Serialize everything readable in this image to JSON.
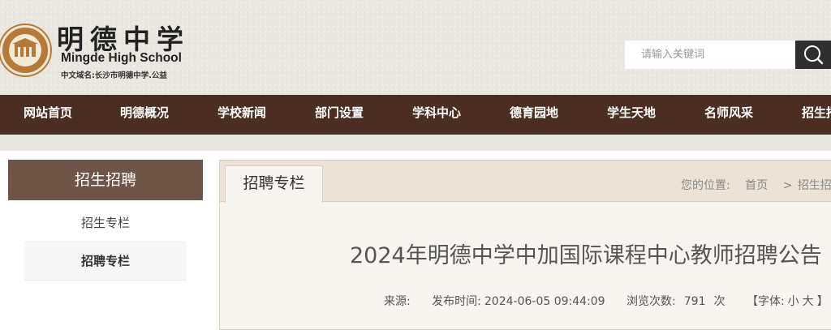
{
  "header": {
    "logo_seal_text": "明德 HIGH SCHOOL 1903",
    "logo_cn": "明德中学",
    "logo_en": "Mingde High School",
    "domain_text": "中文域名:长沙市明德中学.公益"
  },
  "search": {
    "placeholder": "请输入关键词",
    "button_icon": "search-icon"
  },
  "nav": {
    "items": [
      "网站首页",
      "明德概况",
      "学校新闻",
      "部门设置",
      "学科中心",
      "德育园地",
      "学生天地",
      "名师风采",
      "招生招聘"
    ]
  },
  "sidebar": {
    "title": "招生招聘",
    "items": [
      {
        "label": "招生专栏"
      },
      {
        "label": "招聘专栏"
      }
    ]
  },
  "content": {
    "tab_label": "招聘专栏",
    "breadcrumb": {
      "prefix": "您的位置:",
      "home": "首页",
      "sep": ">",
      "current": "招生招聘"
    },
    "article": {
      "title": "2024年明德中学中加国际课程中心教师招聘公告",
      "source_label": "来源:",
      "time_label": "发布时间:",
      "time": "2024-06-05 09:44:09",
      "views_label": "浏览次数:",
      "views": "791",
      "views_unit": "次",
      "font_label": "【字体:",
      "font_small": "小",
      "font_large": "大",
      "font_close": "】"
    }
  },
  "colors": {
    "nav_bg": "#4b2e23",
    "sidebar_title_bg": "#6e5548",
    "header_bg": "#e9e6e0",
    "tab_bar_bg": "#ece2d5"
  }
}
